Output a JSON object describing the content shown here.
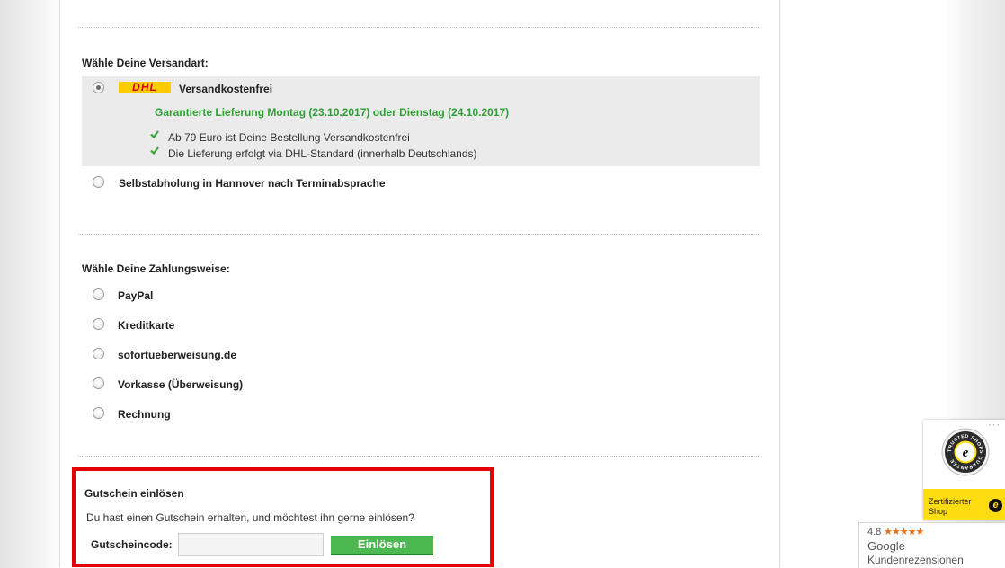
{
  "shipping": {
    "title": "Wähle Deine Versandart:",
    "options": [
      {
        "label": "Versandkostenfrei",
        "logo": "DHL",
        "selected": true
      },
      {
        "label": "Selbstabholung in Hannover nach Terminabsprache",
        "selected": false
      }
    ],
    "delivery_guarantee": "Garantierte Lieferung Montag (23.10.2017) oder Dienstag (24.10.2017)",
    "notes": [
      "Ab 79 Euro ist Deine Bestellung Versandkostenfrei",
      "Die Lieferung erfolgt via DHL-Standard (innerhalb Deutschlands)"
    ]
  },
  "payment": {
    "title": "Wähle Deine Zahlungsweise:",
    "options": [
      "PayPal",
      "Kreditkarte",
      "sofortueberweisung.de",
      "Vorkasse (Überweisung)",
      "Rechnung"
    ]
  },
  "coupon": {
    "title": "Gutschein einlösen",
    "text": "Du hast einen Gutschein erhalten, und möchtest ihn gerne einlösen?",
    "label": "Gutscheincode:",
    "input_value": "",
    "button": "Einlösen"
  },
  "trusted_shops": {
    "seal_text": "TRUSTED SHOPS GUARANTEE",
    "badge_line1": "Zertifizierter",
    "badge_line2": "Shop",
    "menu": "···"
  },
  "google_reviews": {
    "rating": "4.8",
    "stars": "★★★★★",
    "name": "Google",
    "subtitle": "Kundenrezensionen"
  },
  "colors": {
    "green_text": "#2f9e35",
    "button_green": "#4bb94f",
    "highlight_red": "#e40000",
    "dhl_yellow": "#ffcc00",
    "dhl_red": "#d40511",
    "trusted_yellow": "#ffdc0f"
  }
}
